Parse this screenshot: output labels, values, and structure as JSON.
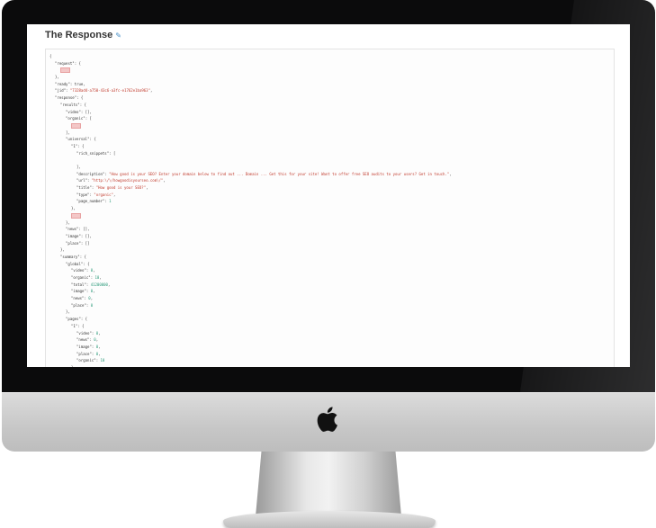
{
  "heading": {
    "title": "The Response",
    "edit_icon": "pencil-icon"
  },
  "logo_icon": "apple-logo-icon",
  "code_lines": [
    {
      "indent": 0,
      "parts": [
        {
          "t": "{",
          "c": "k"
        }
      ]
    },
    {
      "indent": 1,
      "parts": [
        {
          "t": "\"request\"",
          "c": "k"
        },
        {
          "t": ": {",
          "c": "k"
        }
      ]
    },
    {
      "indent": 2,
      "parts": [
        {
          "t": "...",
          "c": "collapsed"
        }
      ]
    },
    {
      "indent": 1,
      "parts": [
        {
          "t": "},",
          "c": "k"
        }
      ]
    },
    {
      "indent": 1,
      "parts": [
        {
          "t": "\"ready\"",
          "c": "k"
        },
        {
          "t": ": true,",
          "c": "k"
        }
      ]
    },
    {
      "indent": 1,
      "parts": [
        {
          "t": "\"jid\"",
          "c": "k"
        },
        {
          "t": ": ",
          "c": "k"
        },
        {
          "t": "\"7328ad4-a750-43c6-a3fc-e1762e1ba963\"",
          "c": "s"
        },
        {
          "t": ",",
          "c": "k"
        }
      ]
    },
    {
      "indent": 1,
      "parts": [
        {
          "t": "\"response\"",
          "c": "k"
        },
        {
          "t": ": {",
          "c": "k"
        }
      ]
    },
    {
      "indent": 2,
      "parts": [
        {
          "t": "\"results\"",
          "c": "k"
        },
        {
          "t": ": {",
          "c": "k"
        }
      ]
    },
    {
      "indent": 3,
      "parts": [
        {
          "t": "\"video\"",
          "c": "k"
        },
        {
          "t": ": [],",
          "c": "k"
        }
      ]
    },
    {
      "indent": 3,
      "parts": [
        {
          "t": "\"organic\"",
          "c": "k"
        },
        {
          "t": ": [",
          "c": "k"
        }
      ]
    },
    {
      "indent": 4,
      "parts": [
        {
          "t": "...",
          "c": "collapsed"
        }
      ]
    },
    {
      "indent": 3,
      "parts": [
        {
          "t": "],",
          "c": "k"
        }
      ]
    },
    {
      "indent": 3,
      "parts": [
        {
          "t": "\"universal\"",
          "c": "k"
        },
        {
          "t": ": {",
          "c": "k"
        }
      ]
    },
    {
      "indent": 4,
      "parts": [
        {
          "t": "\"1\"",
          "c": "k"
        },
        {
          "t": ": {",
          "c": "k"
        }
      ]
    },
    {
      "indent": 5,
      "parts": [
        {
          "t": "\"rich_snippets\"",
          "c": "k"
        },
        {
          "t": ": [",
          "c": "k"
        }
      ]
    },
    {
      "indent": 5,
      "parts": []
    },
    {
      "indent": 5,
      "parts": [
        {
          "t": "],",
          "c": "k"
        }
      ]
    },
    {
      "indent": 5,
      "parts": [
        {
          "t": "\"description\"",
          "c": "k"
        },
        {
          "t": ": ",
          "c": "k"
        },
        {
          "t": "\"How good is your SEO? Enter your domain below to find out ... Domain ... Get this for your site! Want to offer free SEO audits to your users? Get in touch.\"",
          "c": "s"
        },
        {
          "t": ",",
          "c": "k"
        }
      ]
    },
    {
      "indent": 5,
      "parts": [
        {
          "t": "\"url\"",
          "c": "k"
        },
        {
          "t": ": ",
          "c": "k"
        },
        {
          "t": "\"http:\\/\\/howgoodisyourseo.com\\/\"",
          "c": "s"
        },
        {
          "t": ",",
          "c": "k"
        }
      ]
    },
    {
      "indent": 5,
      "parts": [
        {
          "t": "\"title\"",
          "c": "k"
        },
        {
          "t": ": ",
          "c": "k"
        },
        {
          "t": "\"How good is your SEO?\"",
          "c": "s"
        },
        {
          "t": ",",
          "c": "k"
        }
      ]
    },
    {
      "indent": 5,
      "parts": [
        {
          "t": "\"type\"",
          "c": "k"
        },
        {
          "t": ": ",
          "c": "k"
        },
        {
          "t": "\"organic\"",
          "c": "s"
        },
        {
          "t": ",",
          "c": "k"
        }
      ]
    },
    {
      "indent": 5,
      "parts": [
        {
          "t": "\"page_number\"",
          "c": "k"
        },
        {
          "t": ": ",
          "c": "k"
        },
        {
          "t": "1",
          "c": "n"
        }
      ]
    },
    {
      "indent": 4,
      "parts": [
        {
          "t": "},",
          "c": "k"
        }
      ]
    },
    {
      "indent": 4,
      "parts": [
        {
          "t": "...",
          "c": "collapsed"
        }
      ]
    },
    {
      "indent": 3,
      "parts": [
        {
          "t": "},",
          "c": "k"
        }
      ]
    },
    {
      "indent": 3,
      "parts": [
        {
          "t": "\"news\"",
          "c": "k"
        },
        {
          "t": ": [],",
          "c": "k"
        }
      ]
    },
    {
      "indent": 3,
      "parts": [
        {
          "t": "\"image\"",
          "c": "k"
        },
        {
          "t": ": [],",
          "c": "k"
        }
      ]
    },
    {
      "indent": 3,
      "parts": [
        {
          "t": "\"place\"",
          "c": "k"
        },
        {
          "t": ": []",
          "c": "k"
        }
      ]
    },
    {
      "indent": 2,
      "parts": [
        {
          "t": "},",
          "c": "k"
        }
      ]
    },
    {
      "indent": 2,
      "parts": [
        {
          "t": "\"summary\"",
          "c": "k"
        },
        {
          "t": ": {",
          "c": "k"
        }
      ]
    },
    {
      "indent": 3,
      "parts": [
        {
          "t": "\"global\"",
          "c": "k"
        },
        {
          "t": ": {",
          "c": "k"
        }
      ]
    },
    {
      "indent": 4,
      "parts": [
        {
          "t": "\"video\"",
          "c": "k"
        },
        {
          "t": ": ",
          "c": "k"
        },
        {
          "t": "0",
          "c": "n"
        },
        {
          "t": ",",
          "c": "k"
        }
      ]
    },
    {
      "indent": 4,
      "parts": [
        {
          "t": "\"organic\"",
          "c": "k"
        },
        {
          "t": ": ",
          "c": "k"
        },
        {
          "t": "10",
          "c": "n"
        },
        {
          "t": ",",
          "c": "k"
        }
      ]
    },
    {
      "indent": 4,
      "parts": [
        {
          "t": "\"total\"",
          "c": "k"
        },
        {
          "t": ": ",
          "c": "k"
        },
        {
          "t": "41200000",
          "c": "n"
        },
        {
          "t": ",",
          "c": "k"
        }
      ]
    },
    {
      "indent": 4,
      "parts": [
        {
          "t": "\"image\"",
          "c": "k"
        },
        {
          "t": ": ",
          "c": "k"
        },
        {
          "t": "0",
          "c": "n"
        },
        {
          "t": ",",
          "c": "k"
        }
      ]
    },
    {
      "indent": 4,
      "parts": [
        {
          "t": "\"news\"",
          "c": "k"
        },
        {
          "t": ": ",
          "c": "k"
        },
        {
          "t": "0",
          "c": "n"
        },
        {
          "t": ",",
          "c": "k"
        }
      ]
    },
    {
      "indent": 4,
      "parts": [
        {
          "t": "\"place\"",
          "c": "k"
        },
        {
          "t": ": ",
          "c": "k"
        },
        {
          "t": "0",
          "c": "n"
        }
      ]
    },
    {
      "indent": 3,
      "parts": [
        {
          "t": "},",
          "c": "k"
        }
      ]
    },
    {
      "indent": 3,
      "parts": [
        {
          "t": "\"pages\"",
          "c": "k"
        },
        {
          "t": ": {",
          "c": "k"
        }
      ]
    },
    {
      "indent": 4,
      "parts": [
        {
          "t": "\"1\"",
          "c": "k"
        },
        {
          "t": ": {",
          "c": "k"
        }
      ]
    },
    {
      "indent": 5,
      "parts": [
        {
          "t": "\"video\"",
          "c": "k"
        },
        {
          "t": ": ",
          "c": "k"
        },
        {
          "t": "0",
          "c": "n"
        },
        {
          "t": ",",
          "c": "k"
        }
      ]
    },
    {
      "indent": 5,
      "parts": [
        {
          "t": "\"news\"",
          "c": "k"
        },
        {
          "t": ": ",
          "c": "k"
        },
        {
          "t": "0",
          "c": "n"
        },
        {
          "t": ",",
          "c": "k"
        }
      ]
    },
    {
      "indent": 5,
      "parts": [
        {
          "t": "\"image\"",
          "c": "k"
        },
        {
          "t": ": ",
          "c": "k"
        },
        {
          "t": "0",
          "c": "n"
        },
        {
          "t": ",",
          "c": "k"
        }
      ]
    },
    {
      "indent": 5,
      "parts": [
        {
          "t": "\"place\"",
          "c": "k"
        },
        {
          "t": ": ",
          "c": "k"
        },
        {
          "t": "0",
          "c": "n"
        },
        {
          "t": ",",
          "c": "k"
        }
      ]
    },
    {
      "indent": 5,
      "parts": [
        {
          "t": "\"organic\"",
          "c": "k"
        },
        {
          "t": ": ",
          "c": "k"
        },
        {
          "t": "10",
          "c": "n"
        }
      ]
    },
    {
      "indent": 4,
      "parts": [
        {
          "t": "},",
          "c": "k"
        }
      ]
    }
  ],
  "colors": {
    "key": "#333333",
    "string": "#c0392b",
    "number": "#2a9a7a"
  }
}
